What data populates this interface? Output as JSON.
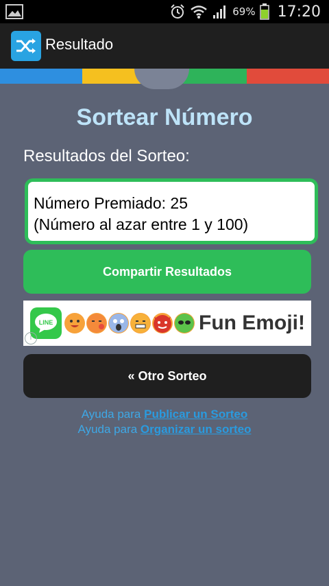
{
  "status_bar": {
    "battery_percent": "69%",
    "time": "17:20",
    "icons": [
      "gallery-icon",
      "alarm-icon",
      "wifi-icon",
      "signal-icon",
      "battery-icon"
    ]
  },
  "action_bar": {
    "app_icon": "shuffle-icon",
    "title": "Resultado"
  },
  "colors": {
    "background": "#5c6375",
    "color_strip": [
      "#2e8fe0",
      "#f5c01f",
      "#2eb35a",
      "#e14b3b"
    ],
    "green": "#2ebd59",
    "heading": "#bde3f8",
    "link": "#2a9bdf"
  },
  "main": {
    "heading": "Sortear Número",
    "subheading": "Resultados del Sorteo:",
    "result_lines": [
      "Número Premiado: 25",
      "(Número al azar entre 1 y 100)"
    ],
    "share_button": "Compartir Resultados",
    "other_button": "« Otro Sorteo"
  },
  "ad": {
    "logo_text": "LINE",
    "brand": "Fun Emoji!"
  },
  "help": [
    {
      "prefix": "Ayuda para ",
      "link": "Publicar un Sorteo"
    },
    {
      "prefix": "Ayuda para ",
      "link": "Organizar un sorteo"
    }
  ]
}
